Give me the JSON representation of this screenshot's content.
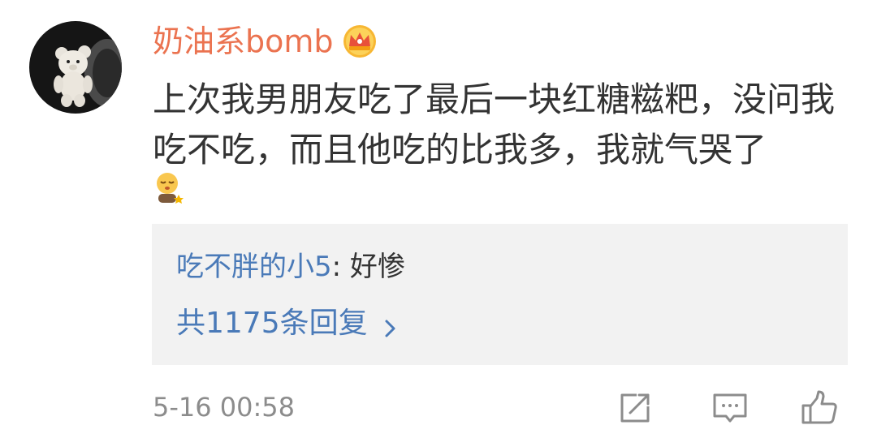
{
  "comment": {
    "username": "奶油系bomb",
    "badge_icon": "crown-icon",
    "text": "上次我男朋友吃了最后一块红糖糍粑，没问我吃不吃，而且他吃的比我多，我就气哭了",
    "emoji_icon": "sleepy-face-icon",
    "timestamp": "5-16 00:58"
  },
  "replies": {
    "top_reply": {
      "user": "吃不胖的小5",
      "separator": ":",
      "text": "好惨"
    },
    "count_label": "共1175条回复",
    "count_icon": "chevron-right-icon"
  },
  "actions": {
    "share_icon": "share-icon",
    "reply_icon": "comment-icon",
    "like_icon": "thumbs-up-icon"
  },
  "colors": {
    "username": "#eb7350",
    "link": "#4a7ab8",
    "text": "#333333",
    "meta": "#8c8c8c",
    "reply_bg": "#f2f2f2"
  }
}
